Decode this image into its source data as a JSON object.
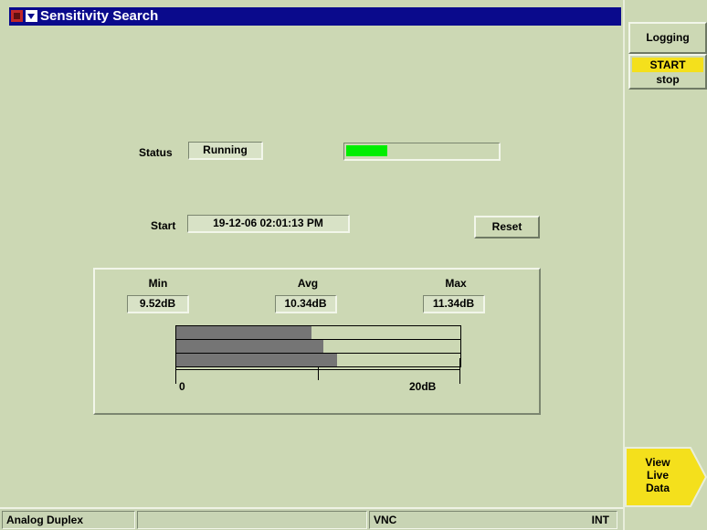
{
  "window": {
    "title": "Sensitivity Search"
  },
  "status": {
    "label": "Status",
    "value": "Running",
    "progress_fraction": 0.27
  },
  "start": {
    "label": "Start",
    "value": "19-12-06 02:01:13 PM"
  },
  "reset_button": {
    "label": "Reset"
  },
  "stats": {
    "min_label": "Min",
    "min_value": "9.52dB",
    "avg_label": "Avg",
    "avg_value": "10.34dB",
    "max_label": "Max",
    "max_value": "11.34dB",
    "scale_min_label": "0",
    "scale_max_label": "20dB",
    "scale_max": 20,
    "bar_values": [
      9.52,
      10.34,
      11.34
    ]
  },
  "softkeys": {
    "logging": "Logging",
    "start": "START",
    "stop": "stop",
    "view_live_data": [
      "View",
      "Live",
      "Data"
    ]
  },
  "statusbar": {
    "mode": "Analog Duplex",
    "center": "",
    "vnc": "VNC",
    "int": "INT"
  },
  "colors": {
    "background": "#ccd8b4",
    "titlebar": "#0a0a8c",
    "progress": "#00ee00",
    "highlight_key": "#f4e01c",
    "bar_fill": "#757575"
  }
}
